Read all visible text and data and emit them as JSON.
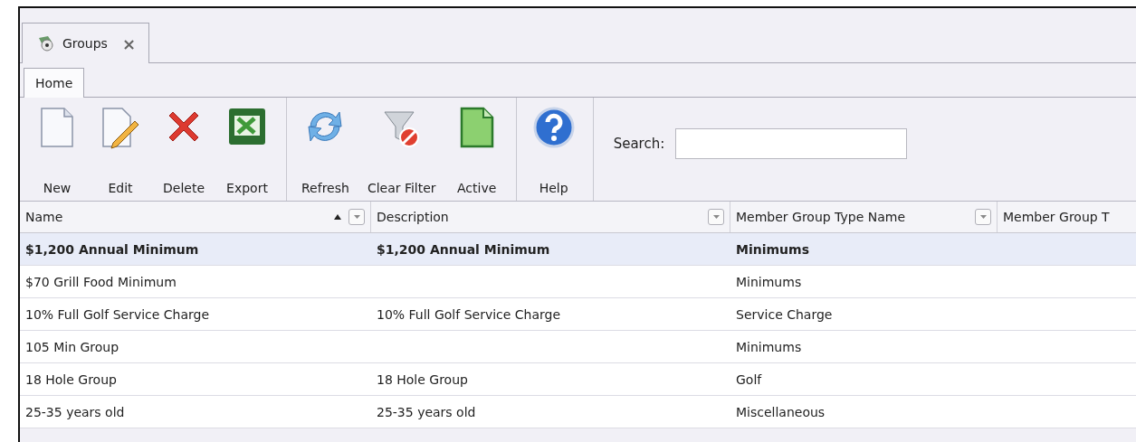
{
  "document_tab": {
    "label": "Groups",
    "close": "×"
  },
  "ribbon_tabs": [
    {
      "label": "Home",
      "selected": true
    }
  ],
  "toolbar": {
    "groups": [
      {
        "buttons": [
          {
            "label": "New",
            "kind": "new"
          },
          {
            "label": "Edit",
            "kind": "edit"
          },
          {
            "label": "Delete",
            "kind": "delete"
          },
          {
            "label": "Export",
            "kind": "export"
          }
        ]
      },
      {
        "buttons": [
          {
            "label": "Refresh",
            "kind": "refresh"
          },
          {
            "label": "Clear Filter",
            "kind": "clearfilter"
          },
          {
            "label": "Active",
            "kind": "active"
          }
        ]
      },
      {
        "buttons": [
          {
            "label": "Help",
            "kind": "help"
          }
        ]
      }
    ],
    "search": {
      "label": "Search:"
    }
  },
  "table": {
    "columns": [
      {
        "label": "Name",
        "sorted": true,
        "filter_button": true
      },
      {
        "label": "Description",
        "filter_button": true
      },
      {
        "label": "Member Group Type Name",
        "filter_button": true
      },
      {
        "label": "Member Group T",
        "filter_button": false
      }
    ],
    "rows": [
      {
        "selected": true,
        "cells": [
          "$1,200 Annual Minimum",
          "$1,200 Annual Minimum",
          "Minimums"
        ]
      },
      {
        "selected": false,
        "cells": [
          "$70 Grill Food Minimum",
          "",
          "Minimums"
        ]
      },
      {
        "selected": false,
        "cells": [
          "10% Full Golf Service Charge",
          "10% Full Golf Service Charge",
          "Service Charge"
        ]
      },
      {
        "selected": false,
        "cells": [
          "105 Min Group",
          "",
          "Minimums"
        ]
      },
      {
        "selected": false,
        "cells": [
          "18 Hole Group",
          "18 Hole Group",
          "Golf"
        ]
      },
      {
        "selected": false,
        "cells": [
          "25-35 years old",
          "25-35 years old",
          "Miscellaneous"
        ]
      }
    ]
  }
}
